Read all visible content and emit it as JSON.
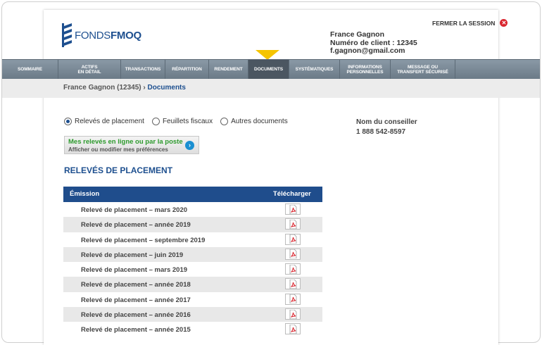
{
  "brand": {
    "name_light": "FONDS",
    "name_bold": "FMOQ",
    "color": "#1d4f8f"
  },
  "header": {
    "user_name": "France Gagnon",
    "client_number": "Numéro de client : 12345",
    "email": "f.gagnon@gmail.com",
    "logout_label": "FERMER LA SESSION"
  },
  "nav": {
    "items": [
      {
        "l1": "SOMMAIRE",
        "l2": ""
      },
      {
        "l1": "ACTIFS",
        "l2": "EN DÉTAIL"
      },
      {
        "l1": "TRANSACTIONS",
        "l2": ""
      },
      {
        "l1": "RÉPARTITION",
        "l2": ""
      },
      {
        "l1": "RENDEMENT",
        "l2": ""
      },
      {
        "l1": "DOCUMENTS",
        "l2": ""
      },
      {
        "l1": "SYSTÉMATIQUES",
        "l2": ""
      },
      {
        "l1": "INFORMATIONS",
        "l2": "PERSONNELLES"
      },
      {
        "l1": "MESSAGE OU",
        "l2": "TRANSFERT SÉCURISÉ"
      }
    ],
    "active": "DOCUMENTS"
  },
  "breadcrumb": {
    "parent": "France Gagnon (12345)",
    "separator": " › ",
    "current": "Documents"
  },
  "doc_types": {
    "options": [
      "Relevés de placement",
      "Feuillets fiscaux",
      "Autres documents"
    ],
    "selected": "Relevés de placement"
  },
  "advisor": {
    "label": "Nom du conseiller",
    "phone": "1 888 542-8597"
  },
  "preferences": {
    "title": "Mes relevés en ligne ou par la poste",
    "subtitle": "Afficher ou modifier mes préférences"
  },
  "section_title": "RELEVÉS DE PLACEMENT",
  "table": {
    "headers": {
      "issue": "Émission",
      "download": "Télécharger"
    },
    "rows": [
      "Relevé de placement – mars 2020",
      "Relevé de placement – année 2019",
      "Relevé de placement – septembre 2019",
      "Relevé de placement – juin 2019",
      "Relevé de placement – mars 2019",
      "Relevé de placement – année 2018",
      "Relevé de placement – année 2017",
      "Relevé de placement – année 2016",
      "Relevé de placement – année 2015"
    ]
  },
  "colors": {
    "nav_bg": "#7a8996",
    "accent_yellow": "#f5c400",
    "header_blue": "#1f4d8c",
    "pdf_red": "#d9262f",
    "link_green": "#2d9a2d"
  }
}
